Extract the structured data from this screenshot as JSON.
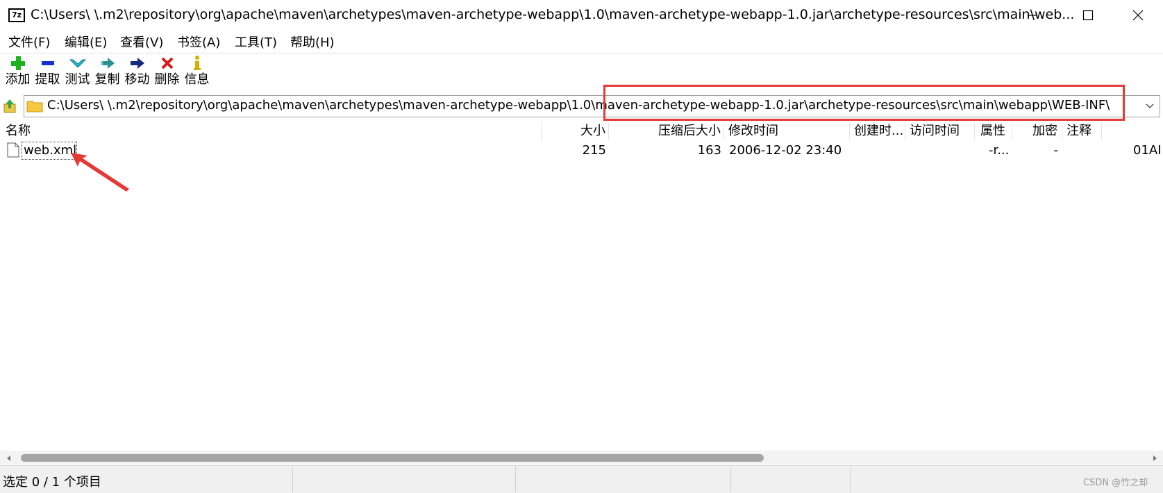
{
  "window": {
    "title": "C:\\Users\\ \\.m2\\repository\\org\\apache\\maven\\archetypes\\maven-archetype-webapp\\1.0\\maven-archetype-webapp-1.0.jar\\archetype-resources\\src\\main\\web...",
    "app_icon_text": "7z",
    "controls": [
      "minimize-icon",
      "maximize-icon",
      "close-icon"
    ]
  },
  "menu": [
    "文件(F)",
    "编辑(E)",
    "查看(V)",
    "书签(A)",
    "工具(T)",
    "帮助(H)"
  ],
  "toolbar": [
    {
      "label": "添加",
      "icon": "plus-icon",
      "color": "#1bb51b"
    },
    {
      "label": "提取",
      "icon": "minus-icon",
      "color": "#1a2fd0"
    },
    {
      "label": "测试",
      "icon": "check-chevron-icon",
      "color": "#22b8c8"
    },
    {
      "label": "复制",
      "icon": "copy-arrow-icon",
      "color": "#2a9090"
    },
    {
      "label": "移动",
      "icon": "move-arrow-icon",
      "color": "#1a2a80"
    },
    {
      "label": "删除",
      "icon": "delete-x-icon",
      "color": "#d81a1a"
    },
    {
      "label": "信息",
      "icon": "info-icon",
      "color": "#d4b000"
    }
  ],
  "address": {
    "path": "C:\\Users\\ \\.m2\\repository\\org\\apache\\maven\\archetypes\\maven-archetype-webapp\\1.0\\maven-archetype-webapp-1.0.jar\\archetype-resources\\src\\main\\webapp\\WEB-INF\\",
    "highlight_color": "#e53935"
  },
  "columns": [
    "名称",
    "大小",
    "压缩后大小",
    "修改时间",
    "创建时...",
    "访问时间",
    "属性",
    "加密",
    "注释"
  ],
  "files": [
    {
      "name": "web.xml",
      "size": "215",
      "packed": "163",
      "modified": "2006-12-02 23:40",
      "created": "",
      "accessed": "",
      "attributes": "-r...",
      "encrypted": "-",
      "comment": "",
      "extra": "01AI"
    }
  ],
  "status": {
    "text": "选定 0 / 1 个项目",
    "watermark": "CSDN @竹之却"
  }
}
